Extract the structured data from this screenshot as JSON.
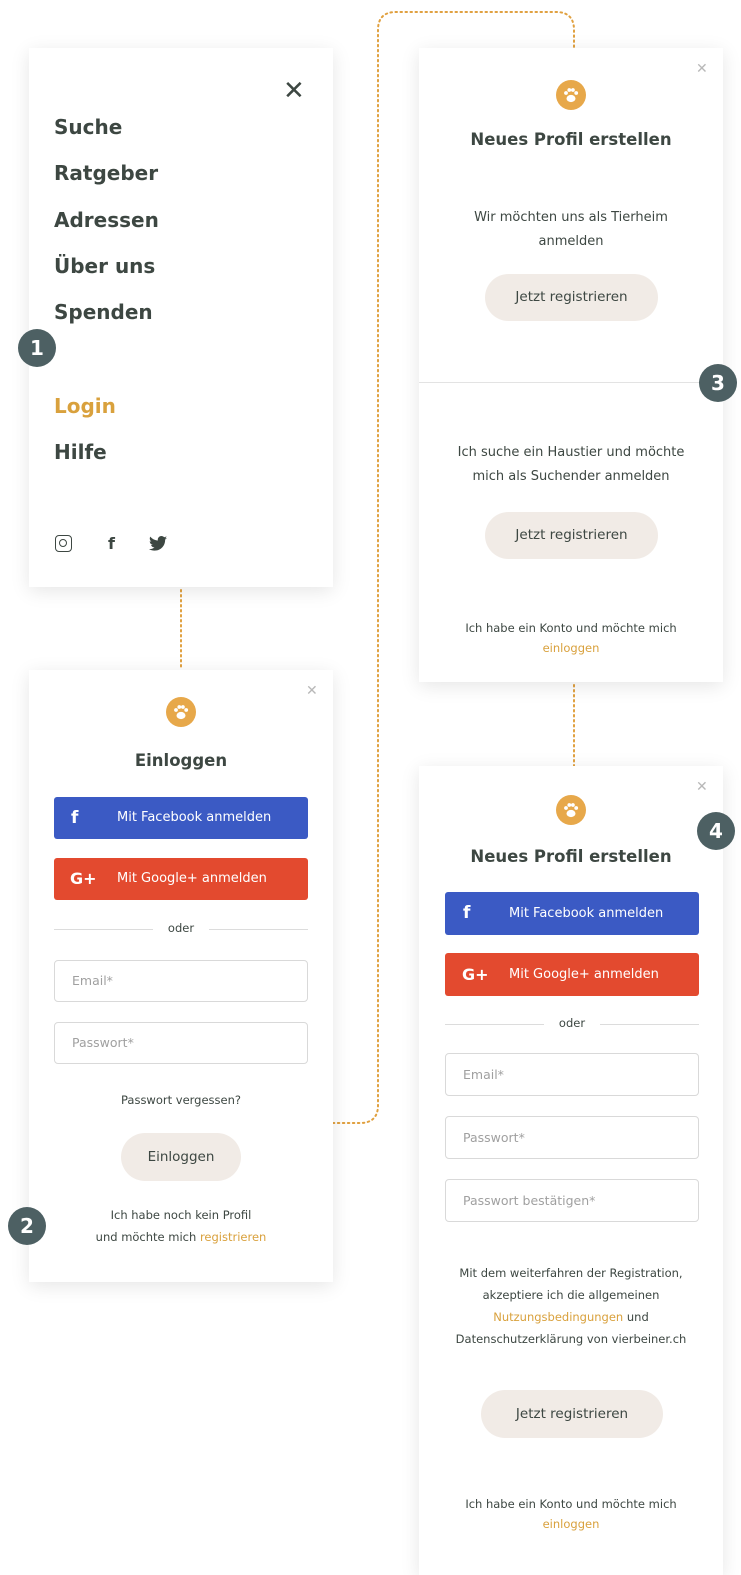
{
  "colors": {
    "accent": "#d9a13d",
    "step_badge": "#4d6063",
    "facebook": "#3b5ac4",
    "google": "#e34a2f",
    "soft_button": "#f1ebe6"
  },
  "steps": [
    "1",
    "2",
    "3",
    "4"
  ],
  "menu": {
    "close_icon": "close-icon",
    "items": [
      "Suche",
      "Ratgeber",
      "Adressen",
      "Über uns",
      "Spenden"
    ],
    "login": "Login",
    "help": "Hilfe",
    "social": [
      {
        "name": "instagram-icon",
        "glyph": "◎"
      },
      {
        "name": "facebook-icon",
        "glyph": "f"
      },
      {
        "name": "twitter-icon",
        "glyph": "🐦"
      }
    ]
  },
  "login": {
    "title": "Einloggen",
    "facebook_label": "Mit Facebook anmelden",
    "google_label": "Mit Google+ anmelden",
    "facebook_icon": "f",
    "google_icon": "G+",
    "or": "oder",
    "email_placeholder": "Email*",
    "password_placeholder": "Passwort*",
    "forgot": "Passwort vergessen?",
    "submit": "Einloggen",
    "no_profile_line1": "Ich habe noch kein Profil",
    "no_profile_line2": "und möchte mich",
    "register_link": "registrieren"
  },
  "choose": {
    "title": "Neues Profil erstellen",
    "shelter_text_line1": "Wir möchten uns als Tierheim",
    "shelter_text_line2": "anmelden",
    "shelter_button": "Jetzt registrieren",
    "seeker_text_line1": "Ich suche ein Haustier und möchte",
    "seeker_text_line2": "mich als Suchender anmelden",
    "seeker_button": "Jetzt registrieren",
    "have_account": "Ich habe ein Konto und möchte mich",
    "login_link": "einloggen"
  },
  "register": {
    "title": "Neues Profil erstellen",
    "facebook_label": "Mit Facebook anmelden",
    "google_label": "Mit Google+ anmelden",
    "facebook_icon": "f",
    "google_icon": "G+",
    "or": "oder",
    "email_placeholder": "Email*",
    "password_placeholder": "Passwort*",
    "password_confirm_placeholder": "Passwort bestätigen*",
    "terms_line1": "Mit dem weiterfahren der Registration,",
    "terms_line2": "akzeptiere ich die allgemeinen",
    "terms_link": "Nutzungsbedingungen",
    "terms_and": "und",
    "terms_line4": "Datenschutzerklärung von vierbeiner.ch",
    "submit": "Jetzt registrieren",
    "have_account": "Ich habe ein Konto und möchte mich",
    "login_link": "einloggen"
  }
}
